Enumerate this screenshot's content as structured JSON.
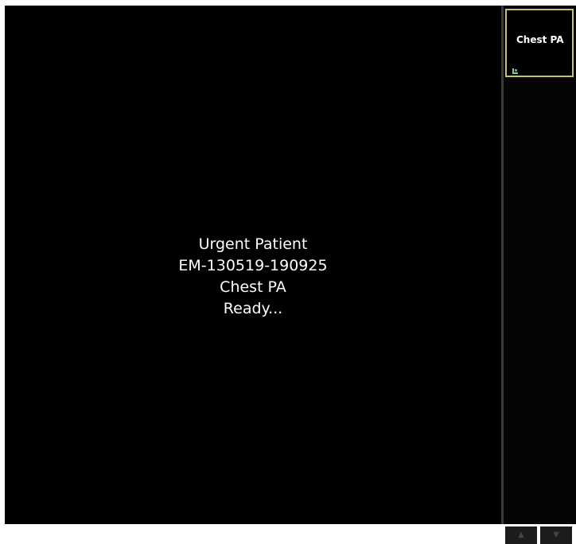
{
  "viewer": {
    "lines": [
      "Urgent Patient",
      "EM-130519-190925",
      "Chest PA",
      "Ready..."
    ]
  },
  "thumbnail": {
    "label": "Chest PA"
  },
  "scroll": {
    "up_icon": "▲",
    "down_icon": "▼"
  },
  "colors": {
    "background": "#000000",
    "text": "#ffffff",
    "thumbnail_border": "#c7c466"
  }
}
